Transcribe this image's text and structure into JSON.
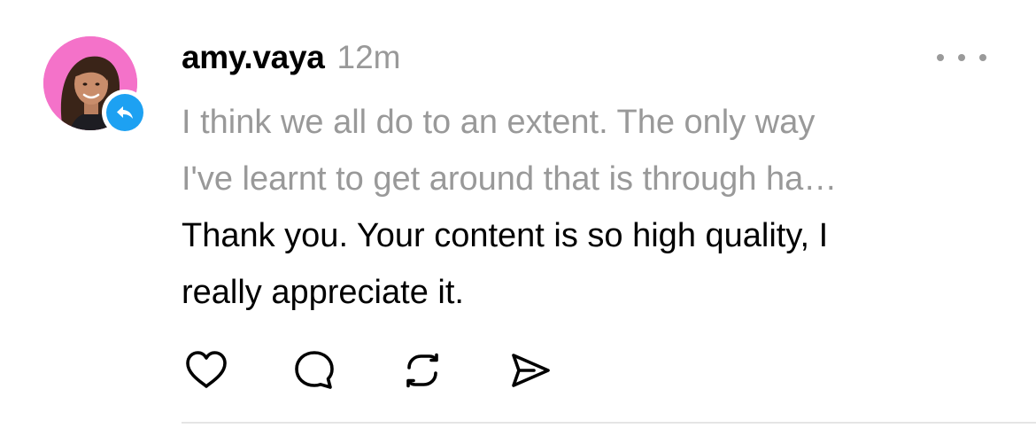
{
  "colors": {
    "accent_blue": "#1da1f2",
    "muted_text": "#999999",
    "primary_text": "#000000",
    "divider": "#e5e5e5",
    "avatar_bg": "#f472c9"
  },
  "post": {
    "avatar_icon": "user-avatar",
    "reply_badge_icon": "reply-arrow-icon",
    "username": "amy.vaya",
    "timestamp": "12m",
    "more_icon": "more-horizontal-icon",
    "quoted_lines": [
      "I think we all do to an extent. The only way",
      "I've learnt to get around that is through ha…"
    ],
    "reply_lines": [
      "Thank you. Your content is so high quality, I",
      "really appreciate it."
    ],
    "actions": [
      {
        "name": "like",
        "icon": "heart-icon"
      },
      {
        "name": "comment",
        "icon": "comment-bubble-icon"
      },
      {
        "name": "repost",
        "icon": "repost-icon"
      },
      {
        "name": "share",
        "icon": "send-icon"
      }
    ]
  }
}
